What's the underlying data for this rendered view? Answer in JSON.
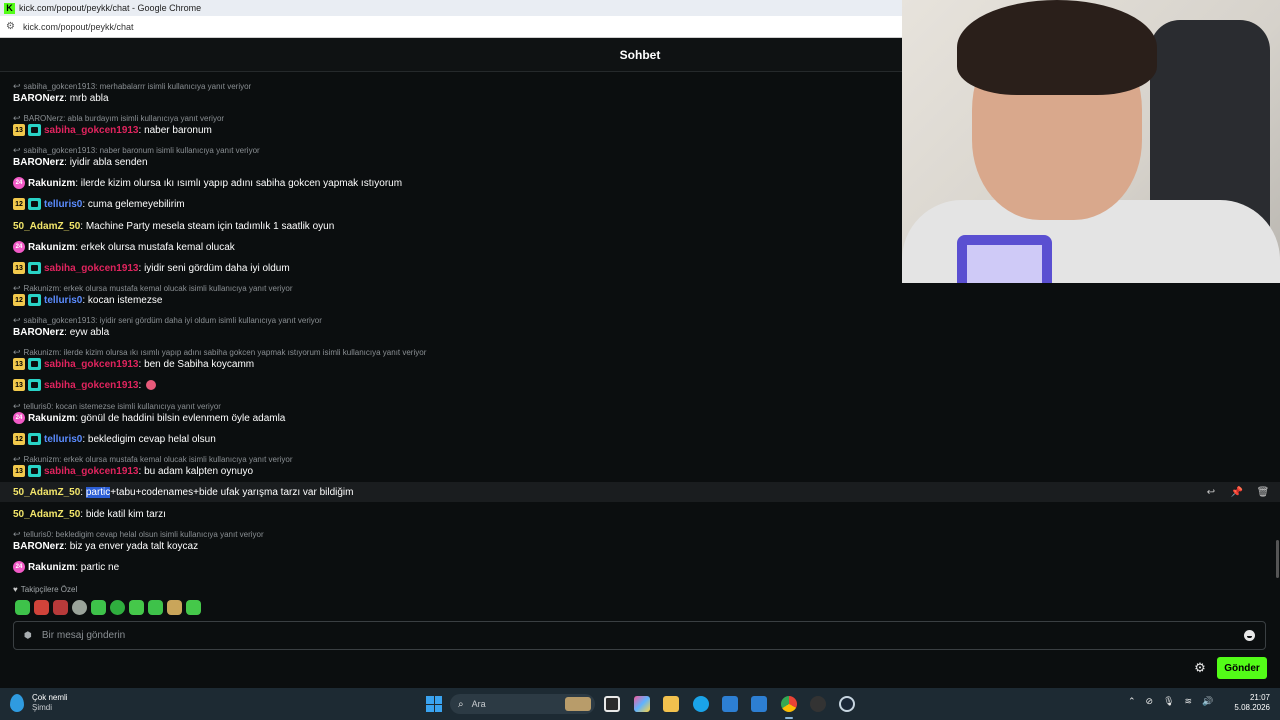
{
  "window": {
    "title": "kick.com/popout/peykk/chat - Google Chrome",
    "url": "kick.com/popout/peykk/chat"
  },
  "chat": {
    "header_title": "Sohbet",
    "followers_only_label": "Takipçilere Özel",
    "input_placeholder": "Bir mesaj gönderin",
    "send_label": "Gönder",
    "replies": [
      "sabiha_gokcen1913: merhabalarrr isimli kullanıcıya yanıt veriyor",
      "BARONerz: abla burdayım isimli kullanıcıya yanıt veriyor",
      "sabiha_gokcen1913: naber baronum isimli kullanıcıya yanıt veriyor",
      "Rakunizm: erkek olursa mustafa kemal olucak isimli kullanıcıya yanıt veriyor",
      "sabiha_gokcen1913: iyidir seni gördüm daha iyi oldum isimli kullanıcıya yanıt veriyor",
      "Rakunizm: ilerde kizim olursa ıkı ısımlı yapıp adını sabiha gokcen yapmak ıstıyorum isimli kullanıcıya yanıt veriyor",
      "telluris0: kocan istemezse isimli kullanıcıya yanıt veriyor",
      "Rakunizm: erkek olursa mustafa kemal olucak isimli kullanıcıya yanıt veriyor",
      "telluris0: bekledigim cevap helal olsun isimli kullanıcıya yanıt veriyor"
    ],
    "messages": [
      {
        "user": "BARONerz",
        "text": "mrb abla",
        "badge": ""
      },
      {
        "user": "sabiha_gokcen1913",
        "text": "naber baronum",
        "badge": "13"
      },
      {
        "user": "BARONerz",
        "text": "iyidir abla senden",
        "badge": ""
      },
      {
        "user": "Rakunizm",
        "text": "ilerde kizim olursa ıkı ısımlı yapıp adını sabiha gokcen yapmak ıstıyorum",
        "badge": "24"
      },
      {
        "user": "telluris0",
        "text": "cuma gelemeyebilirim",
        "badge": "12"
      },
      {
        "user": "50_AdamZ_50",
        "text": "Machine Party mesela steam için tadımlık 1 saatlik oyun",
        "badge": ""
      },
      {
        "user": "Rakunizm",
        "text": "erkek olursa mustafa kemal olucak",
        "badge": "24"
      },
      {
        "user": "sabiha_gokcen1913",
        "text": "iyidir seni gördüm daha iyi oldum",
        "badge": "13"
      },
      {
        "user": "telluris0",
        "text": "kocan istemezse",
        "badge": "12"
      },
      {
        "user": "BARONerz",
        "text": "eyw abla",
        "badge": ""
      },
      {
        "user": "sabiha_gokcen1913",
        "text": "ben de Sabiha koycamm",
        "badge": "13"
      },
      {
        "user": "sabiha_gokcen1913",
        "text": "",
        "badge": "13"
      },
      {
        "user": "Rakunizm",
        "text": "gönül de haddini bilsin evlenmem öyle adamla",
        "badge": "24"
      },
      {
        "user": "telluris0",
        "text": "bekledigim cevap helal olsun",
        "badge": "12"
      },
      {
        "user": "sabiha_gokcen1913",
        "text": "bu adam kalpten oynuyo",
        "badge": "13"
      },
      {
        "user": "50_AdamZ_50",
        "text_sel": "partic",
        "text": "+tabu+codenames+bide ufak yarışma tarzı var bildiğim",
        "badge": ""
      },
      {
        "user": "50_AdamZ_50",
        "text": "bide katil kim tarzı",
        "badge": ""
      },
      {
        "user": "BARONerz",
        "text": "biz ya enver yada talt koycaz",
        "badge": ""
      },
      {
        "user": "Rakunizm",
        "text": "partic ne",
        "badge": "24"
      }
    ]
  },
  "taskbar": {
    "weather_title": "Çok nemli",
    "weather_sub": "Şimdi",
    "search_placeholder": "Ara",
    "time": "21:07",
    "date": "5.08.2026"
  },
  "colors": {
    "accent": "#53fc18",
    "user_red": "#e0245e",
    "user_blue": "#5b8cff",
    "user_yellow": "#f3e66b"
  }
}
